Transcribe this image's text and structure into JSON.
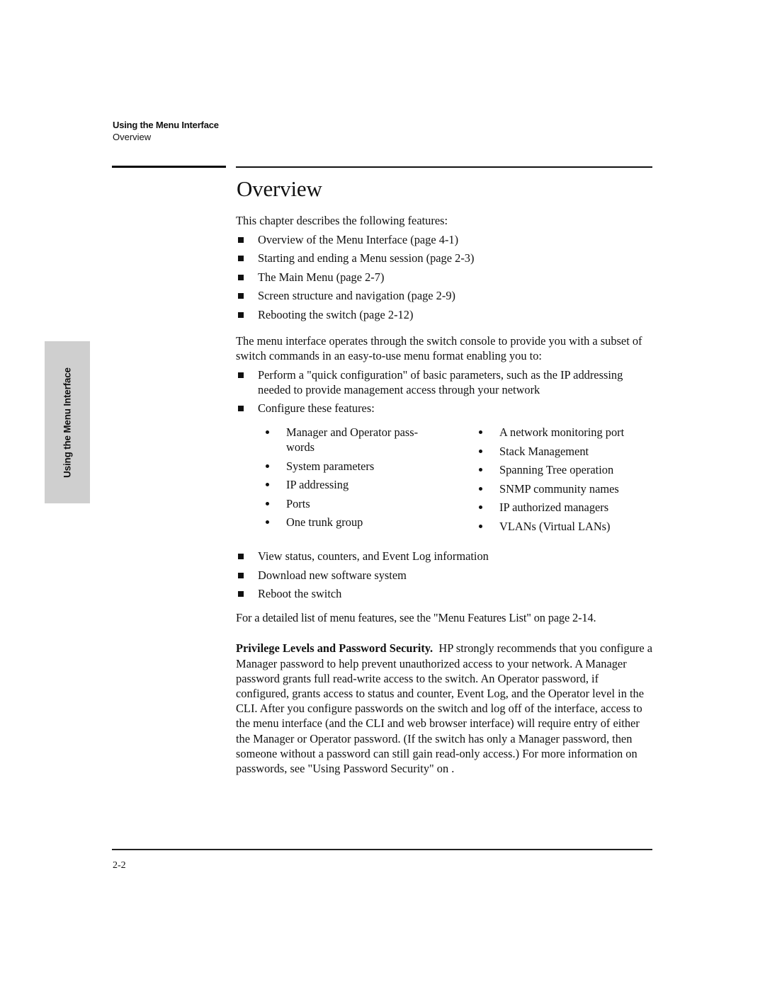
{
  "running_head": {
    "chapter": "Using the Menu Interface",
    "section": "Overview"
  },
  "side_tab": {
    "label": "Using the Menu Interface"
  },
  "heading": "Overview",
  "intro": "This chapter describes the following features:",
  "chapter_features": [
    "Overview of the Menu Interface (page 4-1)",
    "Starting and ending a Menu session (page 2-3)",
    "The Main Menu (page 2-7)",
    "Screen structure and navigation (page 2-9)",
    "Rebooting the switch (page 2-12)"
  ],
  "menu_description": "The menu interface operates through the switch console to provide you with a subset of switch commands in an easy-to-use menu format enabling you to:",
  "capabilities": [
    "Perform a \"quick configuration\" of basic parameters, such as the IP addressing needed to provide management access through your network",
    "Configure these features:"
  ],
  "configurable_features": {
    "left": [
      "Manager and Operator pass- words",
      "System parameters",
      "IP addressing",
      "Ports",
      "One trunk group"
    ],
    "right": [
      "A network monitoring port",
      "Stack Management",
      "Spanning Tree operation",
      "SNMP community names",
      "IP authorized managers",
      "VLANs (Virtual LANs)"
    ]
  },
  "more_capabilities": [
    "View status, counters, and Event Log information",
    "Download new software system",
    "Reboot the switch"
  ],
  "features_list_ref": "For a detailed list of menu features, see the \"Menu Features List\" on page 2-14.",
  "privilege": {
    "title": "Privilege Levels and Password Security.",
    "body": "HP strongly recommends that you configure a Manager password to help prevent unauthorized access to your network. A Manager password grants full read-write access to the switch. An Operator password, if configured, grants access to status and counter, Event Log, and the Operator level in the CLI. After you configure passwords on the switch and log off of the interface,  access to the menu interface (and the CLI and web browser interface) will require entry of either the Manager or Operator password. (If the switch has only a Manager password, then someone without a password can still gain read-only access.) For more information on passwords, see \"Using Password Security\" on ."
  },
  "footer": {
    "page_number": "2-2"
  }
}
